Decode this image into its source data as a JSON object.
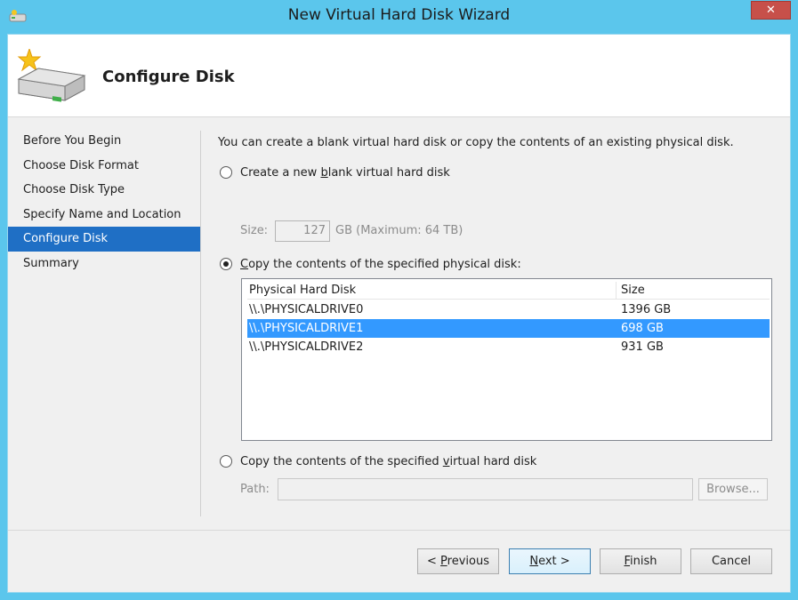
{
  "window": {
    "title": "New Virtual Hard Disk Wizard",
    "close_label": "✕"
  },
  "header": {
    "title": "Configure Disk",
    "icon": "new-hard-disk-icon"
  },
  "nav": {
    "items": [
      {
        "label": "Before You Begin"
      },
      {
        "label": "Choose Disk Format"
      },
      {
        "label": "Choose Disk Type"
      },
      {
        "label": "Specify Name and Location"
      },
      {
        "label": "Configure Disk",
        "active": true
      },
      {
        "label": "Summary"
      }
    ]
  },
  "content": {
    "intro": "You can create a blank virtual hard disk or copy the contents of an existing physical disk.",
    "option_blank": {
      "pre": "Create a new ",
      "accel": "b",
      "post": "lank virtual hard disk"
    },
    "size": {
      "label": "Size:",
      "value": "127",
      "unit": "GB (Maximum: 64 TB)"
    },
    "option_physical": {
      "accel": "C",
      "post": "opy the contents of the specified physical disk:"
    },
    "disk_list": {
      "columns": [
        "Physical Hard Disk",
        "Size"
      ],
      "rows": [
        {
          "name": "\\\\.\\PHYSICALDRIVE0",
          "size": "1396 GB"
        },
        {
          "name": "\\\\.\\PHYSICALDRIVE1",
          "size": "698 GB",
          "selected": true
        },
        {
          "name": "\\\\.\\PHYSICALDRIVE2",
          "size": "931 GB"
        }
      ]
    },
    "option_virtual": {
      "pre": "Copy the contents of the specified ",
      "accel": "v",
      "post": "irtual hard disk"
    },
    "path": {
      "label": "Path:",
      "value": ""
    },
    "browse_label": "Browse..."
  },
  "buttons": {
    "previous": {
      "pre": "< ",
      "accel": "P",
      "post": "revious"
    },
    "next": {
      "accel": "N",
      "post": "ext >"
    },
    "finish": {
      "accel": "F",
      "post": "inish"
    },
    "cancel": "Cancel"
  },
  "colors": {
    "title_bar": "#5bc6ec",
    "selection": "#3399ff",
    "nav_active": "#1f6fc5",
    "close": "#c7504a"
  }
}
